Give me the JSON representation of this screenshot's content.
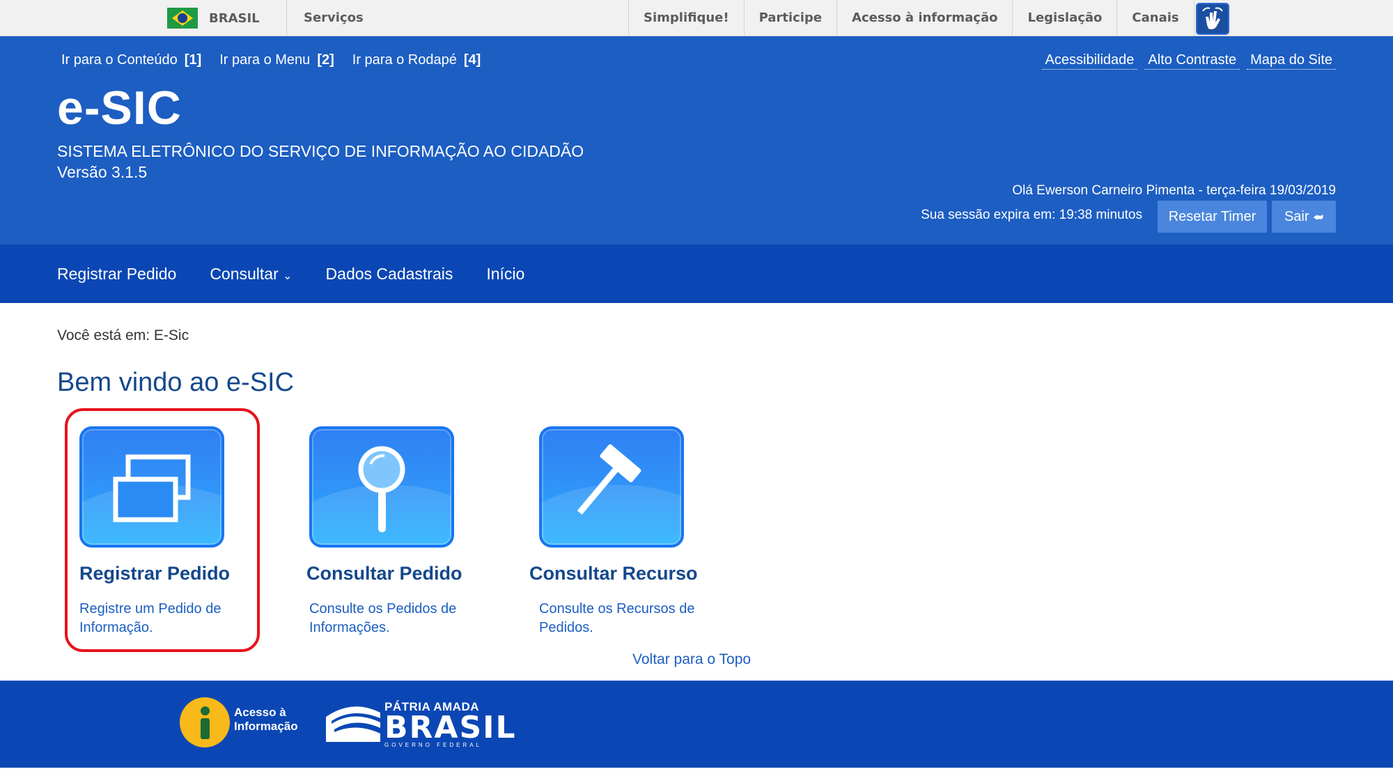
{
  "govbar": {
    "country": "BRASIL",
    "servicos": "Serviços",
    "links": [
      "Simplifique!",
      "Participe",
      "Acesso à informação",
      "Legislação",
      "Canais"
    ]
  },
  "header": {
    "skip_links": [
      {
        "label": "Ir para o Conteúdo",
        "key": "[1]"
      },
      {
        "label": "Ir para o Menu",
        "key": "[2]"
      },
      {
        "label": "Ir para o Rodapé",
        "key": "[4]"
      }
    ],
    "accessibility_links": [
      "Acessibilidade",
      "Alto Contraste",
      "Mapa do Site"
    ],
    "title": "e-SIC",
    "subtitle": "SISTEMA ELETRÔNICO DO SERVIÇO DE INFORMAÇÃO AO CIDADÃO",
    "version": "Versão 3.1.5",
    "greeting": "Olá Ewerson Carneiro Pimenta - terça-feira 19/03/2019",
    "session_text": "Sua sessão expira em: 19:38 minutos",
    "reset_button": "Resetar Timer",
    "logout_button": "Sair"
  },
  "nav": {
    "items": [
      "Registrar Pedido",
      "Consultar",
      "Dados Cadastrais",
      "Início"
    ]
  },
  "main": {
    "breadcrumb": "Você está em: E-Sic",
    "title": "Bem vindo ao e-SIC",
    "tiles": [
      {
        "title": "Registrar Pedido",
        "desc_line1": "Registre um Pedido de",
        "desc_line2": "Informação.",
        "icon": "windows-icon"
      },
      {
        "title": "Consultar Pedido",
        "desc_line1": "Consulte os Pedidos de",
        "desc_line2": "Informações.",
        "icon": "magnifier-icon"
      },
      {
        "title": "Consultar Recurso",
        "desc_line1": "Consulte os Recursos de",
        "desc_line2": "Pedidos.",
        "icon": "gavel-icon"
      }
    ],
    "back_to_top": "Voltar para o Topo"
  },
  "footer": {
    "acesso_line1": "Acesso à",
    "acesso_line2": "Informação",
    "patria_line1": "PÁTRIA AMADA",
    "patria_line2": "BRASIL",
    "patria_line3": "GOVERNO FEDERAL"
  },
  "colors": {
    "header_blue": "#1d5ec2",
    "nav_blue": "#0b47b4",
    "title_blue": "#14488c",
    "highlight_red": "#e8121b"
  }
}
